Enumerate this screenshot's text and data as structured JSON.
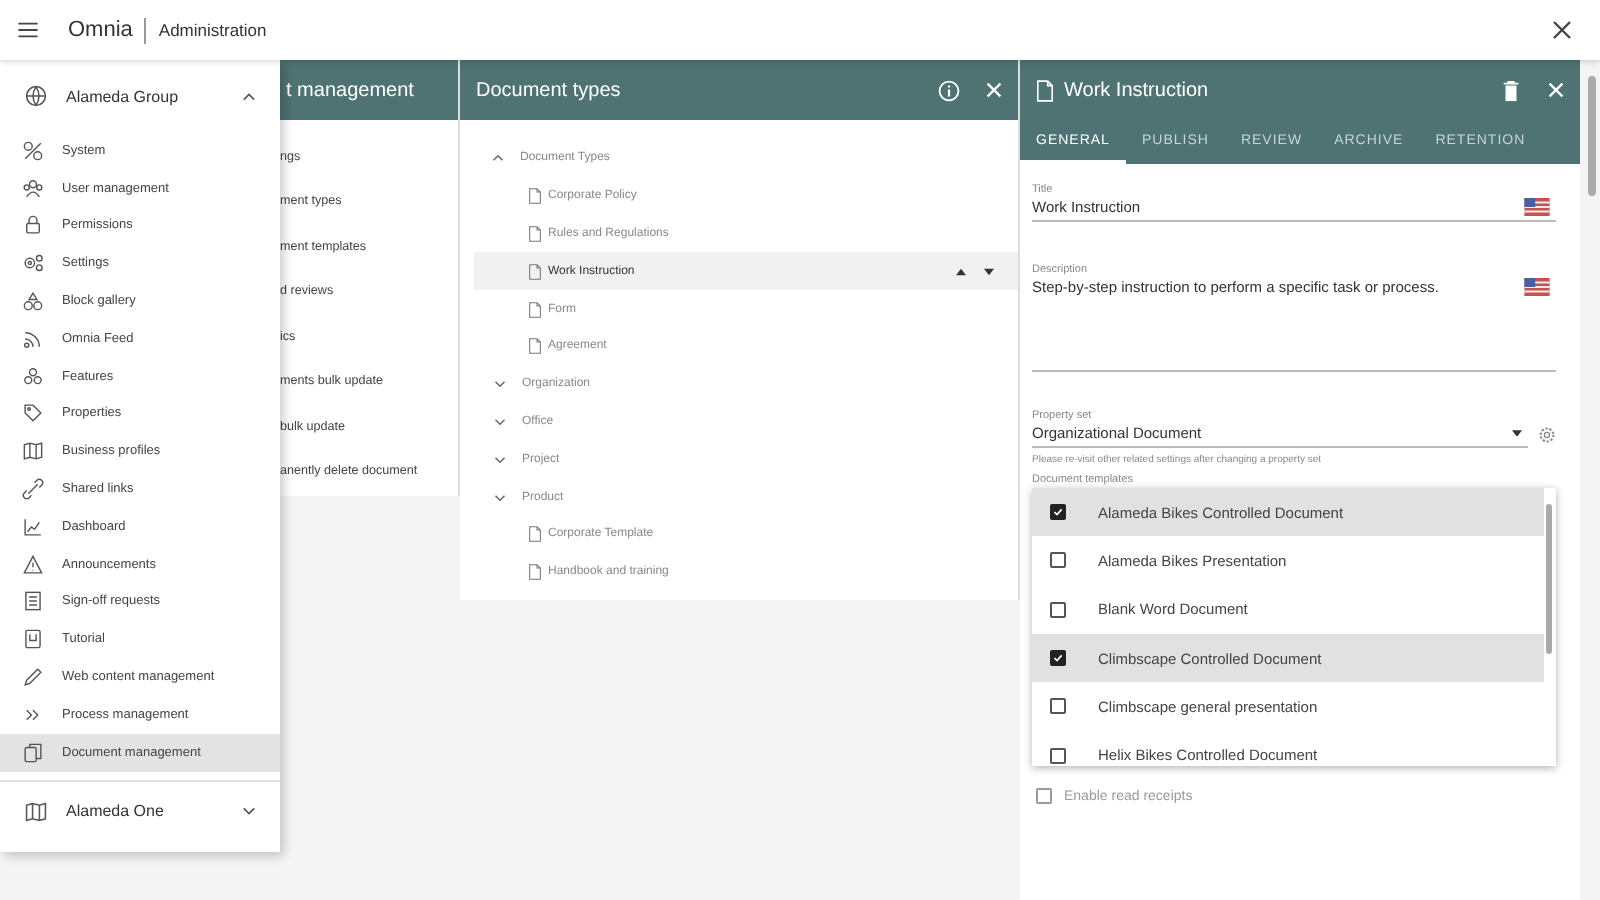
{
  "topbar": {
    "brand": "Omnia",
    "section": "Administration"
  },
  "sidebar": {
    "groups": [
      {
        "label": "Alameda Group",
        "expanded": true,
        "items": [
          {
            "label": "System",
            "selected": false
          },
          {
            "label": "User management",
            "selected": false
          },
          {
            "label": "Permissions",
            "selected": false
          },
          {
            "label": "Settings",
            "selected": false
          },
          {
            "label": "Block gallery",
            "selected": false
          },
          {
            "label": "Omnia Feed",
            "selected": false
          },
          {
            "label": "Features",
            "selected": false
          },
          {
            "label": "Properties",
            "selected": false
          },
          {
            "label": "Business profiles",
            "selected": false
          },
          {
            "label": "Shared links",
            "selected": false
          },
          {
            "label": "Dashboard",
            "selected": false
          },
          {
            "label": "Announcements",
            "selected": false
          },
          {
            "label": "Sign-off requests",
            "selected": false
          },
          {
            "label": "Tutorial",
            "selected": false
          },
          {
            "label": "Web content management",
            "selected": false
          },
          {
            "label": "Process management",
            "selected": false
          },
          {
            "label": "Document management",
            "selected": true
          }
        ]
      },
      {
        "label": "Alameda One",
        "expanded": false
      }
    ]
  },
  "management_panel": {
    "title": "t management",
    "items": [
      "ngs",
      "ment types",
      "ment templates",
      "d reviews",
      "ics",
      "ments bulk update",
      "bulk update",
      "anently delete document"
    ]
  },
  "types_panel": {
    "title": "Document types",
    "tree": [
      {
        "label": "Document Types",
        "expanded": true,
        "children": [
          {
            "label": "Corporate Policy",
            "selected": false
          },
          {
            "label": "Rules and Regulations",
            "selected": false
          },
          {
            "label": "Work Instruction",
            "selected": true
          },
          {
            "label": "Form",
            "selected": false
          },
          {
            "label": "Agreement",
            "selected": false
          }
        ]
      },
      {
        "label": "Organization",
        "expanded": false
      },
      {
        "label": "Office",
        "expanded": false
      },
      {
        "label": "Project",
        "expanded": false
      },
      {
        "label": "Product",
        "expanded": false,
        "children": [
          {
            "label": "Corporate Template",
            "selected": false
          },
          {
            "label": "Handbook and training",
            "selected": false
          }
        ]
      }
    ]
  },
  "detail_panel": {
    "title": "Work Instruction",
    "tabs": [
      {
        "label": "GENERAL",
        "selected": true
      },
      {
        "label": "PUBLISH",
        "selected": false
      },
      {
        "label": "REVIEW",
        "selected": false
      },
      {
        "label": "ARCHIVE",
        "selected": false
      },
      {
        "label": "RETENTION",
        "selected": false
      }
    ],
    "title_field": {
      "label": "Title",
      "value": "Work Instruction"
    },
    "description_field": {
      "label": "Description",
      "value": "Step-by-step instruction to perform a specific task or process."
    },
    "property_set": {
      "label": "Property set",
      "value": "Organizational Document",
      "hint": "Please re-visit other related settings after changing a property set"
    },
    "templates": {
      "label": "Document templates",
      "items": [
        {
          "label": "Alameda Bikes Controlled Document",
          "checked": true
        },
        {
          "label": "Alameda Bikes Presentation",
          "checked": false
        },
        {
          "label": "Blank Word Document",
          "checked": false
        },
        {
          "label": "Climbscape Controlled Document",
          "checked": true
        },
        {
          "label": "Climbscape general presentation",
          "checked": false
        },
        {
          "label": "Helix Bikes Controlled Document",
          "checked": false
        }
      ]
    },
    "read_receipts": {
      "label": "Enable read receipts",
      "checked": false
    }
  }
}
